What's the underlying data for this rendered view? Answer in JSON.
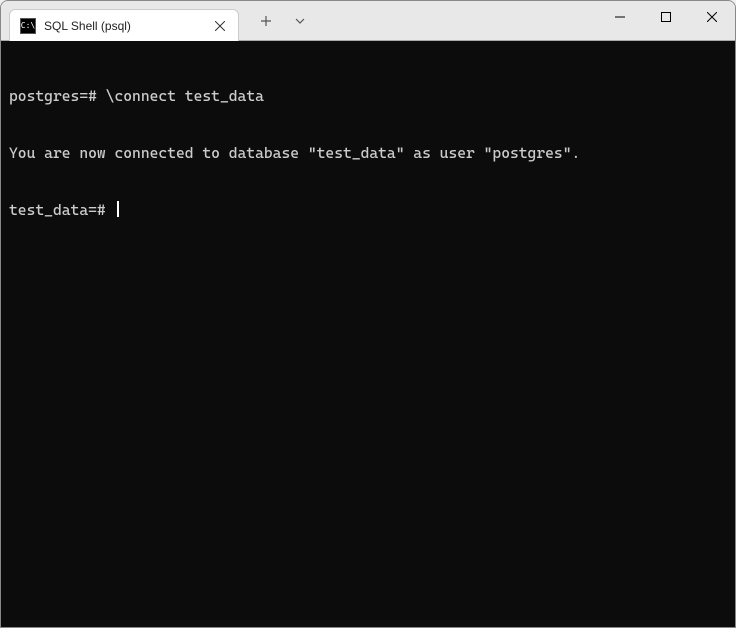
{
  "tab": {
    "title": "SQL Shell (psql)"
  },
  "terminal": {
    "line1_prompt": "postgres=# ",
    "line1_command": "\\connect test_data",
    "line2": "You are now connected to database \"test_data\" as user \"postgres\".",
    "line3_prompt": "test_data=# "
  }
}
